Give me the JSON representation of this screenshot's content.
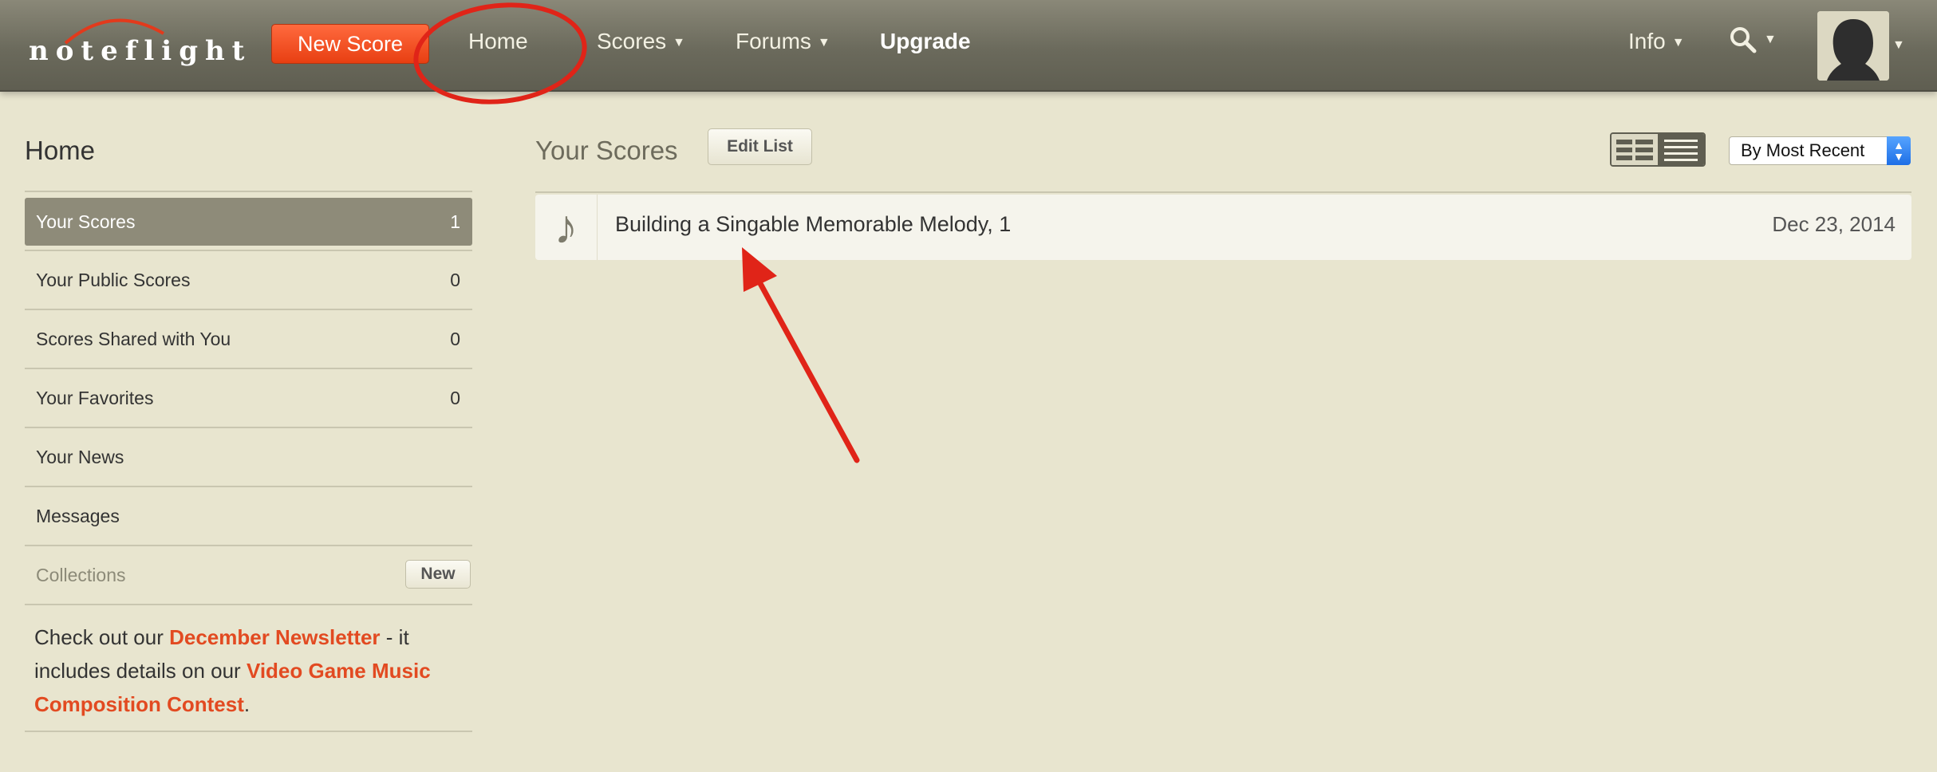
{
  "header": {
    "logo_text": "noteflight",
    "new_score_label": "New Score",
    "nav": {
      "home": "Home",
      "scores": "Scores",
      "forums": "Forums",
      "upgrade": "Upgrade",
      "info": "Info"
    }
  },
  "sidebar": {
    "title": "Home",
    "items": [
      {
        "label": "Your Scores",
        "count": "1"
      },
      {
        "label": "Your Public Scores",
        "count": "0"
      },
      {
        "label": "Scores Shared with You",
        "count": "0"
      },
      {
        "label": "Your Favorites",
        "count": "0"
      },
      {
        "label": "Your News",
        "count": ""
      },
      {
        "label": "Messages",
        "count": ""
      }
    ],
    "collections_label": "Collections",
    "collections_new_label": "New",
    "newsletter": {
      "text_before": "Check out our ",
      "link1": "December Newsletter",
      "text_middle": " - it includes details on our ",
      "link2": "Video Game Music Composition Contest",
      "text_after": "."
    }
  },
  "main": {
    "title": "Your Scores",
    "edit_list_label": "Edit List",
    "sort_selected": "By Most Recent",
    "scores": [
      {
        "title": "Building a Singable Memorable Melody, 1",
        "date": "Dec 23, 2014"
      }
    ]
  },
  "colors": {
    "background": "#e8e5cf",
    "accent": "#e83f12",
    "annotation": "#e02418"
  }
}
